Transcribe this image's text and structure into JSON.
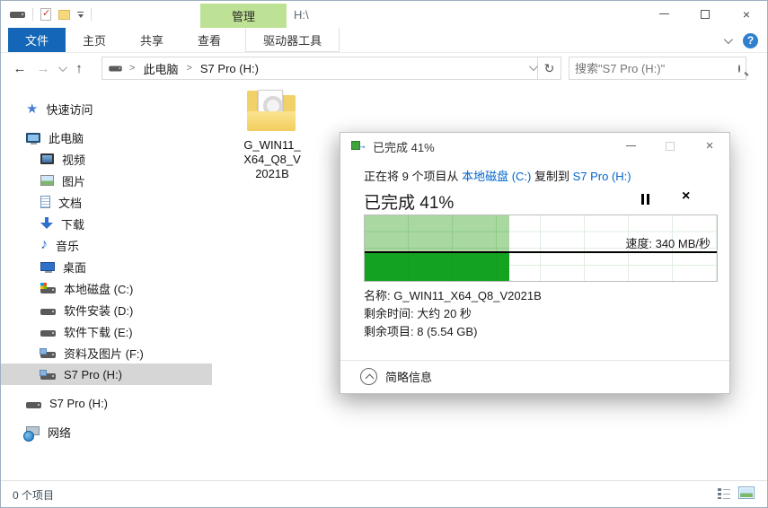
{
  "window": {
    "path_title": "H:\\",
    "contextual_tab_label": "管理"
  },
  "ribbon": {
    "tabs": [
      "文件",
      "主页",
      "共享",
      "查看",
      "驱动器工具"
    ]
  },
  "address": {
    "breadcrumb": [
      "此电脑",
      "S7 Pro (H:)"
    ],
    "separator": ">",
    "search_placeholder": "搜索\"S7 Pro (H:)\""
  },
  "sidebar": {
    "items": [
      {
        "label": "快速访问"
      },
      {
        "label": "此电脑"
      },
      {
        "label": "视频"
      },
      {
        "label": "图片"
      },
      {
        "label": "文档"
      },
      {
        "label": "下载"
      },
      {
        "label": "音乐"
      },
      {
        "label": "桌面"
      },
      {
        "label": "本地磁盘 (C:)"
      },
      {
        "label": "软件安装 (D:)"
      },
      {
        "label": "软件下载 (E:)"
      },
      {
        "label": "资料及图片 (F:)"
      },
      {
        "label": "S7 Pro (H:)",
        "selected": true
      },
      {
        "label": "S7 Pro (H:)"
      },
      {
        "label": "网络"
      }
    ]
  },
  "content": {
    "file_name": "G_WIN11_X64_Q8_V2021B",
    "file_name_lines": [
      "G_WIN11_",
      "X64_Q8_V",
      "2021B"
    ]
  },
  "dialog": {
    "title": "已完成 41%",
    "action_prefix": "正在将 9 个项目从 ",
    "source": "本地磁盘 (C:)",
    "action_middle": " 复制到 ",
    "destination": "S7 Pro (H:)",
    "progress_heading": "已完成 41%",
    "progress_percent": 41,
    "chart": {
      "type": "area",
      "fill_percent": 41,
      "speed_label": "速度: 340 MB/秒",
      "grid": true,
      "fill_color_top": "#a9d8a1",
      "fill_color_bottom": "#14a321"
    },
    "details": [
      "名称: G_WIN11_X64_Q8_V2021B",
      "剩余时间: 大约 20 秒",
      "剩余项目: 8 (5.54 GB)"
    ],
    "footer_toggle_label": "简略信息"
  },
  "statusbar": {
    "items_count": "0 个项目"
  },
  "colors": {
    "file_tab_blue": "#1467b8",
    "contextual_green": "#bee295",
    "link_blue": "#0066cc",
    "selection_gray": "#d6d6d6"
  }
}
